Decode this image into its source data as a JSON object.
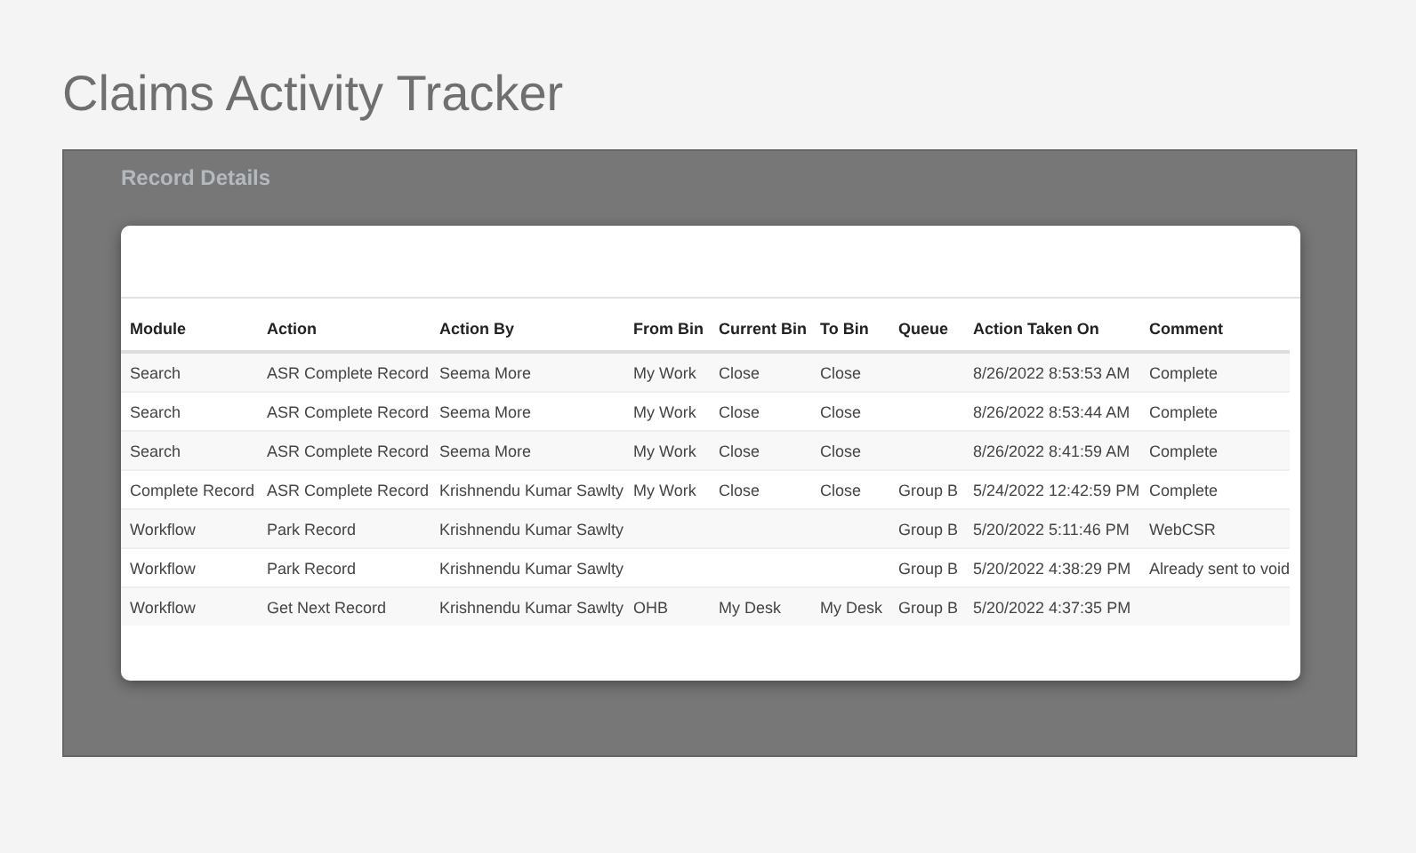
{
  "page_title": "Claims Activity Tracker",
  "background_panel": {
    "title": "Record Details"
  },
  "table": {
    "columns": [
      "Module",
      "Action",
      "Action By",
      "From Bin",
      "Current Bin",
      "To Bin",
      "Queue",
      "Action Taken On",
      "Comment"
    ],
    "rows": [
      [
        "Search",
        "ASR Complete Record",
        "Seema More",
        "My Work",
        "Close",
        "Close",
        null,
        "8/26/2022 8:53:53 AM",
        "Complete"
      ],
      [
        "Search",
        "ASR Complete Record",
        "Seema More",
        "My Work",
        "Close",
        "Close",
        null,
        "8/26/2022 8:53:44 AM",
        "Complete"
      ],
      [
        "Search",
        "ASR Complete Record",
        "Seema More",
        "My Work",
        "Close",
        "Close",
        null,
        "8/26/2022 8:41:59 AM",
        "Complete"
      ],
      [
        "Complete Record",
        "ASR Complete Record",
        "Krishnendu Kumar Sawlty",
        "My Work",
        "Close",
        "Close",
        "Group B",
        "5/24/2022 12:42:59 PM",
        "Complete"
      ],
      [
        "Workflow",
        "Park Record",
        "Krishnendu Kumar Sawlty",
        null,
        null,
        null,
        "Group B",
        "5/20/2022 5:11:46 PM",
        "WebCSR"
      ],
      [
        "Workflow",
        "Park Record",
        "Krishnendu Kumar Sawlty",
        null,
        null,
        null,
        "Group B",
        "5/20/2022 4:38:29 PM",
        "Already sent to void"
      ],
      [
        "Workflow",
        "Get Next Record",
        "Krishnendu Kumar Sawlty",
        "OHB",
        "My Desk",
        "My Desk",
        "Group B",
        "5/20/2022 4:37:35 PM",
        null
      ]
    ]
  }
}
